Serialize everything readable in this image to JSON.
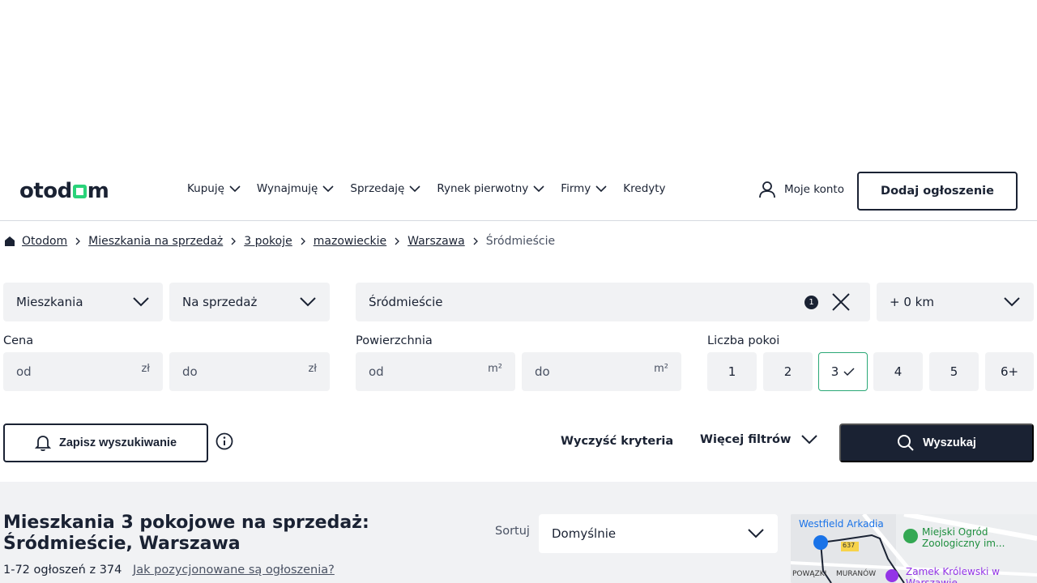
{
  "header": {
    "logo": "otodom",
    "nav": [
      {
        "label": "Kupuję",
        "has_dropdown": true
      },
      {
        "label": "Wynajmuję",
        "has_dropdown": true
      },
      {
        "label": "Sprzedaję",
        "has_dropdown": true
      },
      {
        "label": "Rynek pierwotny",
        "has_dropdown": true
      },
      {
        "label": "Firmy",
        "has_dropdown": true
      },
      {
        "label": "Kredyty",
        "has_dropdown": false
      }
    ],
    "account_label": "Moje konto",
    "add_listing_label": "Dodaj ogłoszenie"
  },
  "breadcrumb": {
    "items": [
      "Otodom",
      "Mieszkania na sprzedaż",
      "3 pokoje",
      "mazowieckie",
      "Warszawa"
    ],
    "current": "Śródmieście"
  },
  "filters": {
    "property_type": "Mieszkania",
    "transaction": "Na sprzedaż",
    "location": "Śródmieście",
    "location_count": "1",
    "distance": "+ 0 km",
    "price_label": "Cena",
    "price_from_placeholder": "od",
    "price_to_placeholder": "do",
    "price_unit": "zł",
    "area_label": "Powierzchnia",
    "area_from_placeholder": "od",
    "area_to_placeholder": "do",
    "area_unit": "m²",
    "rooms_label": "Liczba pokoi",
    "rooms": [
      "1",
      "2",
      "3",
      "4",
      "5",
      "6+"
    ],
    "rooms_selected": "3"
  },
  "actions": {
    "save_search": "Zapisz wyszukiwanie",
    "clear_criteria": "Wyczyść kryteria",
    "more_filters": "Więcej filtrów",
    "search": "Wyszukaj"
  },
  "results": {
    "title": "Mieszkania 3 pokojowe na sprzedaż: Śródmieście, Warszawa",
    "count": "1-72 ogłoszeń z 374",
    "ranking_link": "Jak pozycjonowane są ogłoszenia?",
    "sort_label": "Sortuj",
    "sort_value": "Domyślnie"
  },
  "map": {
    "labels": [
      "Westfield Arkadia",
      "Miejski Ogród Zoologiczny im...",
      "POWĄZKI",
      "MURANÓW",
      "Zamek Królewski w Warszawie",
      "637"
    ]
  },
  "colors": {
    "primary": "#1a2233",
    "accent": "#2ad37a",
    "field_bg": "#f1f2f4",
    "selected_border": "#2aa876"
  }
}
